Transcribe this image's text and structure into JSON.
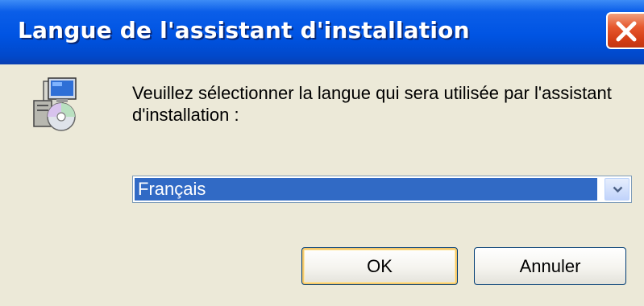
{
  "dialog": {
    "title": "Langue de l'assistant d'installation",
    "message": "Veuillez sélectionner la langue qui sera utilisée par l'assistant d'installation :",
    "language_select": {
      "selected": "Français"
    },
    "buttons": {
      "ok": "OK",
      "cancel": "Annuler"
    },
    "icons": {
      "app": "setup-installer-icon",
      "close": "close-icon",
      "dropdown": "chevron-down-icon"
    }
  },
  "colors": {
    "titlebar": "#0054e3",
    "client_bg": "#ece9d8",
    "selection": "#316ac5",
    "close": "#d23c14"
  }
}
